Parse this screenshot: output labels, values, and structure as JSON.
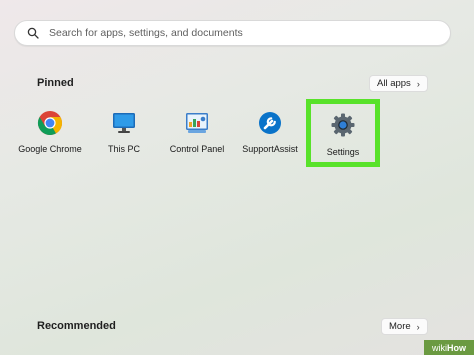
{
  "search": {
    "placeholder": "Search for apps, settings, and documents",
    "icon": "search-icon"
  },
  "pinned": {
    "title": "Pinned",
    "all_apps_label": "All apps",
    "apps": [
      {
        "label": "Google Chrome",
        "icon": "chrome-icon"
      },
      {
        "label": "This PC",
        "icon": "this-pc-icon"
      },
      {
        "label": "Control Panel",
        "icon": "control-panel-icon"
      },
      {
        "label": "SupportAssist",
        "icon": "supportassist-icon"
      },
      {
        "label": "Settings",
        "icon": "settings-gear-icon",
        "highlighted": true,
        "highlight_color": "#58e22a"
      }
    ]
  },
  "recommended": {
    "title": "Recommended",
    "more_label": "More"
  },
  "watermark": {
    "part1": "wiki",
    "part2": "How"
  }
}
